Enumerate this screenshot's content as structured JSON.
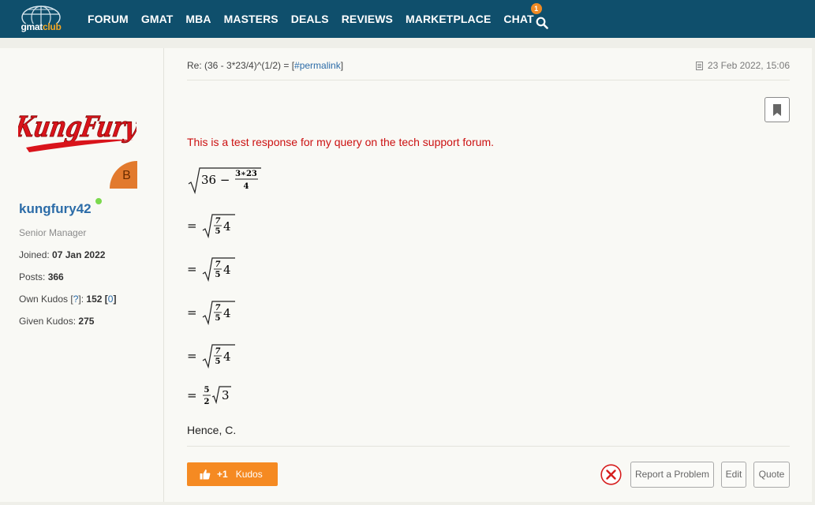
{
  "header": {
    "logo_text_main": "gmat",
    "logo_text_accent": "club",
    "nav": [
      "FORUM",
      "GMAT",
      "MBA",
      "MASTERS",
      "DEALS",
      "REVIEWS",
      "MARKETPLACE",
      "CHAT"
    ],
    "chat_badge": "1",
    "icons": {
      "search": "search-icon",
      "logo": "globe-icon"
    }
  },
  "user": {
    "username": "kungfury42",
    "avatar_text": "KungFury",
    "rank_badge": "B",
    "rank": "Senior Manager",
    "joined_label": "Joined:",
    "joined": "07 Jan 2022",
    "posts_label": "Posts:",
    "posts": "366",
    "own_kudos_label": "Own Kudos",
    "own_kudos_help": "?",
    "own_kudos": "152",
    "own_kudos_link": "0",
    "given_kudos_label": "Given Kudos:",
    "given_kudos": "275"
  },
  "post": {
    "title_prefix": "Re: (36 - 3*23/4)^(1/2) = [",
    "permalink": "#permalink",
    "title_suffix": "]",
    "date": "23 Feb 2022, 15:06",
    "red_text": "This is a test response for my query on the tech support forum.",
    "math": {
      "line1_lead": "36 −",
      "line1_num": "3∗23",
      "line1_den": "4",
      "eq": "=",
      "frac_num": "7",
      "frac_den": "5",
      "tail": "4",
      "last_num": "5",
      "last_den": "2",
      "last_rad": "3"
    },
    "conclusion": "Hence, C."
  },
  "actions": {
    "kudos_plus": "+1",
    "kudos_label": "Kudos",
    "report": "Report a Problem",
    "edit": "Edit",
    "quote": "Quote"
  },
  "colors": {
    "header_bg": "#0f4f6c",
    "accent_orange": "#f58a22",
    "link_blue": "#2c6ca8",
    "red_text": "#cc1111"
  }
}
